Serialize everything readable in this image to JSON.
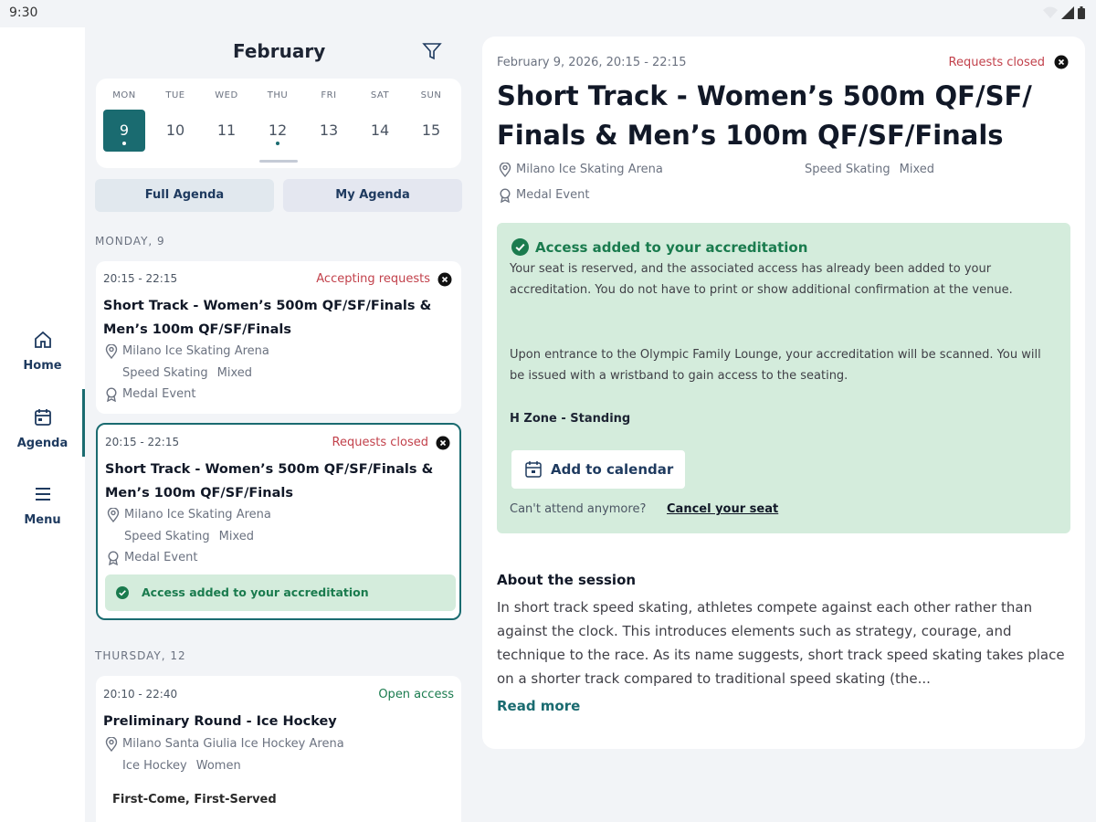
{
  "status_bar": {
    "time": "9:30"
  },
  "nav": {
    "items": [
      {
        "label": "Home"
      },
      {
        "label": "Agenda"
      },
      {
        "label": "Menu"
      }
    ]
  },
  "agenda": {
    "month": "February",
    "week": [
      {
        "name": "MON",
        "num": "9"
      },
      {
        "name": "TUE",
        "num": "10"
      },
      {
        "name": "WED",
        "num": "11"
      },
      {
        "name": "THU",
        "num": "12"
      },
      {
        "name": "FRI",
        "num": "13"
      },
      {
        "name": "SAT",
        "num": "14"
      },
      {
        "name": "SUN",
        "num": "15"
      }
    ],
    "selected_day": "9",
    "tabs": {
      "full": "Full Agenda",
      "mine": "My Agenda"
    },
    "groups": [
      {
        "heading": "MONDAY, 9",
        "events": [
          {
            "time": "20:15 - 22:15",
            "status": "Accepting requests",
            "title": "Short Track - Women’s 500m QF/SF/Finals & Men’s 100m QF/SF/Finals",
            "venue": "Milano Ice Skating Arena",
            "sport": "Speed Skating",
            "gender": "Mixed",
            "tag": "Medal Event"
          },
          {
            "time": "20:15 - 22:15",
            "status": "Requests closed",
            "title": "Short Track - Women’s 500m QF/SF/Finals & Men’s 100m QF/SF/Finals",
            "venue": "Milano Ice Skating Arena",
            "sport": "Speed Skating",
            "gender": "Mixed",
            "tag": "Medal Event",
            "access": "Access added to your accreditation"
          }
        ]
      },
      {
        "heading": "THURSDAY, 12",
        "events": [
          {
            "time": "20:10 - 22:40",
            "status": "Open access",
            "title": "Preliminary Round - Ice Hockey",
            "venue": "Milano Santa Giulia Ice Hockey Arena",
            "sport": "Ice Hockey",
            "gender": "Women",
            "footer": "First-Come, First-Served"
          }
        ]
      }
    ]
  },
  "detail": {
    "datetime": "February 9, 2026, 20:15 - 22:15",
    "status": "Requests closed",
    "title": "Short Track - Women’s 500m QF/SF/ Finals & Men’s 100m QF/SF/Finals",
    "venue": "Milano Ice Skating Arena",
    "sport": "Speed Skating",
    "gender": "Mixed",
    "tag": "Medal Event",
    "access": {
      "title": "Access added to your accreditation",
      "p1": "Your seat is reserved, and the associated access has already been added to your accreditation. You do not have to print or show additional confirmation at the venue.",
      "p2": "Upon entrance to the Olympic Family Lounge, your accreditation will be scanned. You will be issued with a wristband to gain access to the seating.",
      "zone": "H Zone - Standing",
      "calendar_button": "Add to calendar",
      "cant_attend": "Can't attend anymore?",
      "cancel_link": "Cancel your seat"
    },
    "about": {
      "heading": "About the session",
      "text": "In short track speed skating, athletes compete against each other rather than against the clock. This introduces elements such as strategy, courage, and technique to the race. As its name suggests, short track speed skating takes place on a shorter track compared to traditional speed skating (the...",
      "read_more": "Read more"
    }
  },
  "colors": {
    "accent": "#1a6b70",
    "closed": "#c2414b",
    "open": "#1a7b4e",
    "success_bg": "#d4ecdc"
  },
  "icons": [
    "home-icon",
    "calendar-icon",
    "menu-icon",
    "filter-icon",
    "location-pin-icon",
    "medal-icon",
    "close-circle-icon",
    "check-circle-icon",
    "wifi-icon",
    "signal-icon",
    "battery-icon"
  ]
}
